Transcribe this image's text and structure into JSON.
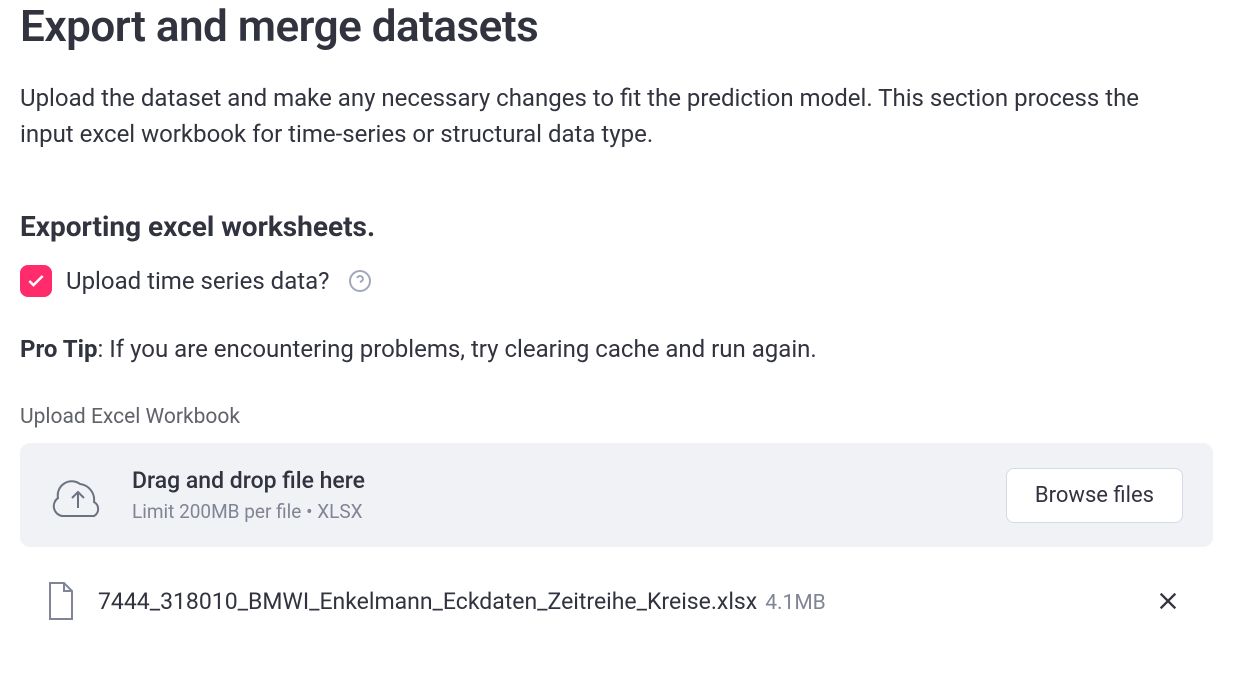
{
  "header": {
    "title": "Export and merge datasets",
    "description": "Upload the dataset and make any necessary changes to fit the prediction model. This section process the input excel workbook for time-series or structural data type."
  },
  "section": {
    "heading": "Exporting excel worksheets.",
    "checkbox": {
      "label": "Upload time series data?",
      "checked": true
    },
    "pro_tip_label": "Pro Tip",
    "pro_tip_text": ": If you are encountering problems, try clearing cache and run again."
  },
  "uploader": {
    "label": "Upload Excel Workbook",
    "dropzone_title": "Drag and drop file here",
    "dropzone_hint": "Limit 200MB per file • XLSX",
    "browse_label": "Browse files"
  },
  "file": {
    "name": "7444_318010_BMWI_Enkelmann_Eckdaten_Zeitreihe_Kreise.xlsx",
    "size": "4.1MB"
  }
}
